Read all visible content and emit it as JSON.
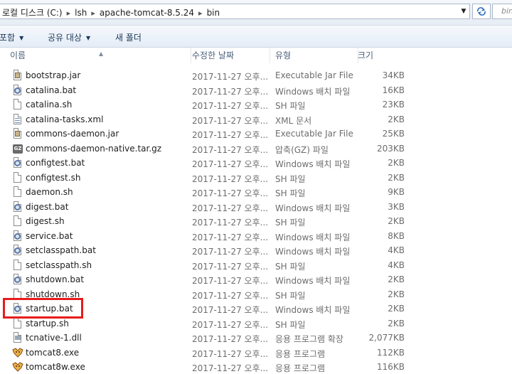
{
  "address": {
    "crumbs": [
      "로컬 디스크 (C:)",
      "lsh",
      "apache-tomcat-8.5.24",
      "bin"
    ],
    "search_placeholder": "bin"
  },
  "toolbar": {
    "include_label": "포함",
    "share_label": "공유 대상",
    "new_folder_label": "새 폴더"
  },
  "columns": {
    "name": "이름",
    "date": "수정한 날짜",
    "type": "유형",
    "size": "크기"
  },
  "files": [
    {
      "name": "bootstrap.jar",
      "date": "2017-11-27 오후...",
      "type": "Executable Jar File",
      "size": "34KB",
      "icon": "jar-file-icon"
    },
    {
      "name": "catalina.bat",
      "date": "2017-11-27 오후...",
      "type": "Windows 배치 파일",
      "size": "16KB",
      "icon": "batch-file-icon"
    },
    {
      "name": "catalina.sh",
      "date": "2017-11-27 오후...",
      "type": "SH 파일",
      "size": "23KB",
      "icon": "document-icon"
    },
    {
      "name": "catalina-tasks.xml",
      "date": "2017-11-27 오후...",
      "type": "XML 문서",
      "size": "2KB",
      "icon": "xml-file-icon"
    },
    {
      "name": "commons-daemon.jar",
      "date": "2017-11-27 오후...",
      "type": "Executable Jar File",
      "size": "25KB",
      "icon": "jar-file-icon"
    },
    {
      "name": "commons-daemon-native.tar.gz",
      "date": "2017-11-27 오후...",
      "type": "압축(GZ) 파일",
      "size": "203KB",
      "icon": "gz-archive-icon"
    },
    {
      "name": "configtest.bat",
      "date": "2017-11-27 오후...",
      "type": "Windows 배치 파일",
      "size": "2KB",
      "icon": "batch-file-icon"
    },
    {
      "name": "configtest.sh",
      "date": "2017-11-27 오후...",
      "type": "SH 파일",
      "size": "2KB",
      "icon": "document-icon"
    },
    {
      "name": "daemon.sh",
      "date": "2017-11-27 오후...",
      "type": "SH 파일",
      "size": "9KB",
      "icon": "document-icon"
    },
    {
      "name": "digest.bat",
      "date": "2017-11-27 오후...",
      "type": "Windows 배치 파일",
      "size": "3KB",
      "icon": "batch-file-icon"
    },
    {
      "name": "digest.sh",
      "date": "2017-11-27 오후...",
      "type": "SH 파일",
      "size": "2KB",
      "icon": "document-icon"
    },
    {
      "name": "service.bat",
      "date": "2017-11-27 오후...",
      "type": "Windows 배치 파일",
      "size": "8KB",
      "icon": "batch-file-icon"
    },
    {
      "name": "setclasspath.bat",
      "date": "2017-11-27 오후...",
      "type": "Windows 배치 파일",
      "size": "4KB",
      "icon": "batch-file-icon"
    },
    {
      "name": "setclasspath.sh",
      "date": "2017-11-27 오후...",
      "type": "SH 파일",
      "size": "4KB",
      "icon": "document-icon"
    },
    {
      "name": "shutdown.bat",
      "date": "2017-11-27 오후...",
      "type": "Windows 배치 파일",
      "size": "2KB",
      "icon": "batch-file-icon"
    },
    {
      "name": "shutdown.sh",
      "date": "2017-11-27 오후...",
      "type": "SH 파일",
      "size": "2KB",
      "icon": "document-icon"
    },
    {
      "name": "startup.bat",
      "date": "2017-11-27 오후...",
      "type": "Windows 배치 파일",
      "size": "2KB",
      "icon": "batch-file-icon",
      "highlighted": true
    },
    {
      "name": "startup.sh",
      "date": "2017-11-27 오후...",
      "type": "SH 파일",
      "size": "2KB",
      "icon": "document-icon"
    },
    {
      "name": "tcnative-1.dll",
      "date": "2017-11-27 오후...",
      "type": "응용 프로그램 확장",
      "size": "2,077KB",
      "icon": "dll-file-icon"
    },
    {
      "name": "tomcat8.exe",
      "date": "2017-11-27 오후...",
      "type": "응용 프로그램",
      "size": "112KB",
      "icon": "tomcat-exe-icon"
    },
    {
      "name": "tomcat8w.exe",
      "date": "2017-11-27 오후...",
      "type": "응용 프로그램",
      "size": "116KB",
      "icon": "tomcat-exe-icon"
    }
  ],
  "colors": {
    "highlight_border": "#e61c1c",
    "secondary_text": "#6d6d6d",
    "toolbar_text": "#1e395b"
  }
}
